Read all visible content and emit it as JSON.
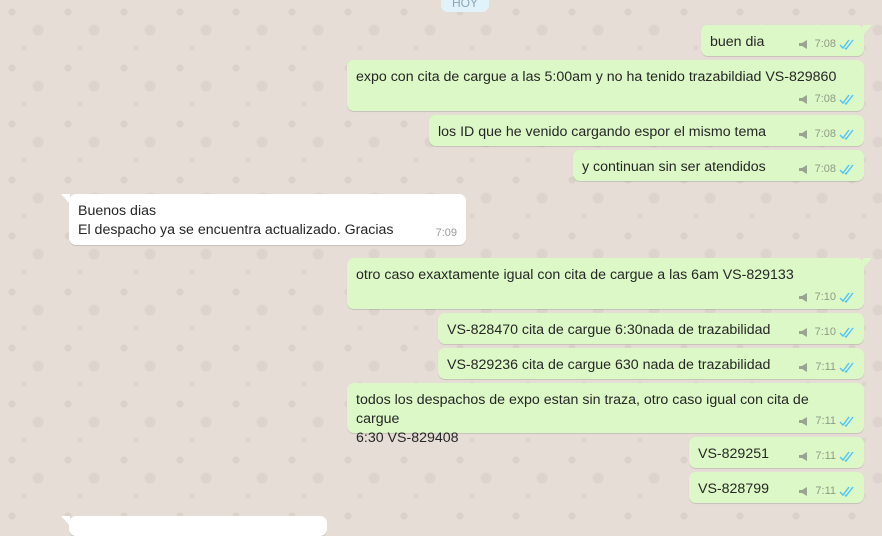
{
  "day_label": "HOY",
  "colors": {
    "outgoing_bg": "#dcf8c6",
    "incoming_bg": "#ffffff",
    "read_ticks": "#4fc3f7",
    "chat_bg": "#e6ded6"
  },
  "messages": [
    {
      "direction": "out",
      "text": "buen dia",
      "time": "7:08",
      "status": "read"
    },
    {
      "direction": "out",
      "text": "expo con cita de cargue a las 5:00am y no ha tenido trazabildiad VS-829860",
      "time": "7:08",
      "status": "read"
    },
    {
      "direction": "out",
      "text": "los ID que he venido cargando espor el mismo tema",
      "time": "7:08",
      "status": "read"
    },
    {
      "direction": "out",
      "text": "y continuan sin ser atendidos",
      "time": "7:08",
      "status": "read"
    },
    {
      "direction": "in",
      "text": "Buenos dias\nEl despacho ya se encuentra actualizado. Gracias",
      "time": "7:09"
    },
    {
      "direction": "out",
      "text": "otro caso exaxtamente igual con cita de cargue a las 6am VS-829133",
      "time": "7:10",
      "status": "read"
    },
    {
      "direction": "out",
      "text": "VS-828470 cita de cargue 6:30nada de trazabilidad",
      "time": "7:10",
      "status": "read"
    },
    {
      "direction": "out",
      "text": "VS-829236 cita de cargue 630 nada de trazabilidad",
      "time": "7:11",
      "status": "read"
    },
    {
      "direction": "out",
      "text": "todos los despachos de expo estan sin traza, otro caso igual con cita de cargue\n6:30 VS-829408",
      "time": "7:11",
      "status": "read"
    },
    {
      "direction": "out",
      "text": "VS-829251",
      "time": "7:11",
      "status": "read"
    },
    {
      "direction": "out",
      "text": "VS-828799",
      "time": "7:11",
      "status": "read"
    }
  ]
}
